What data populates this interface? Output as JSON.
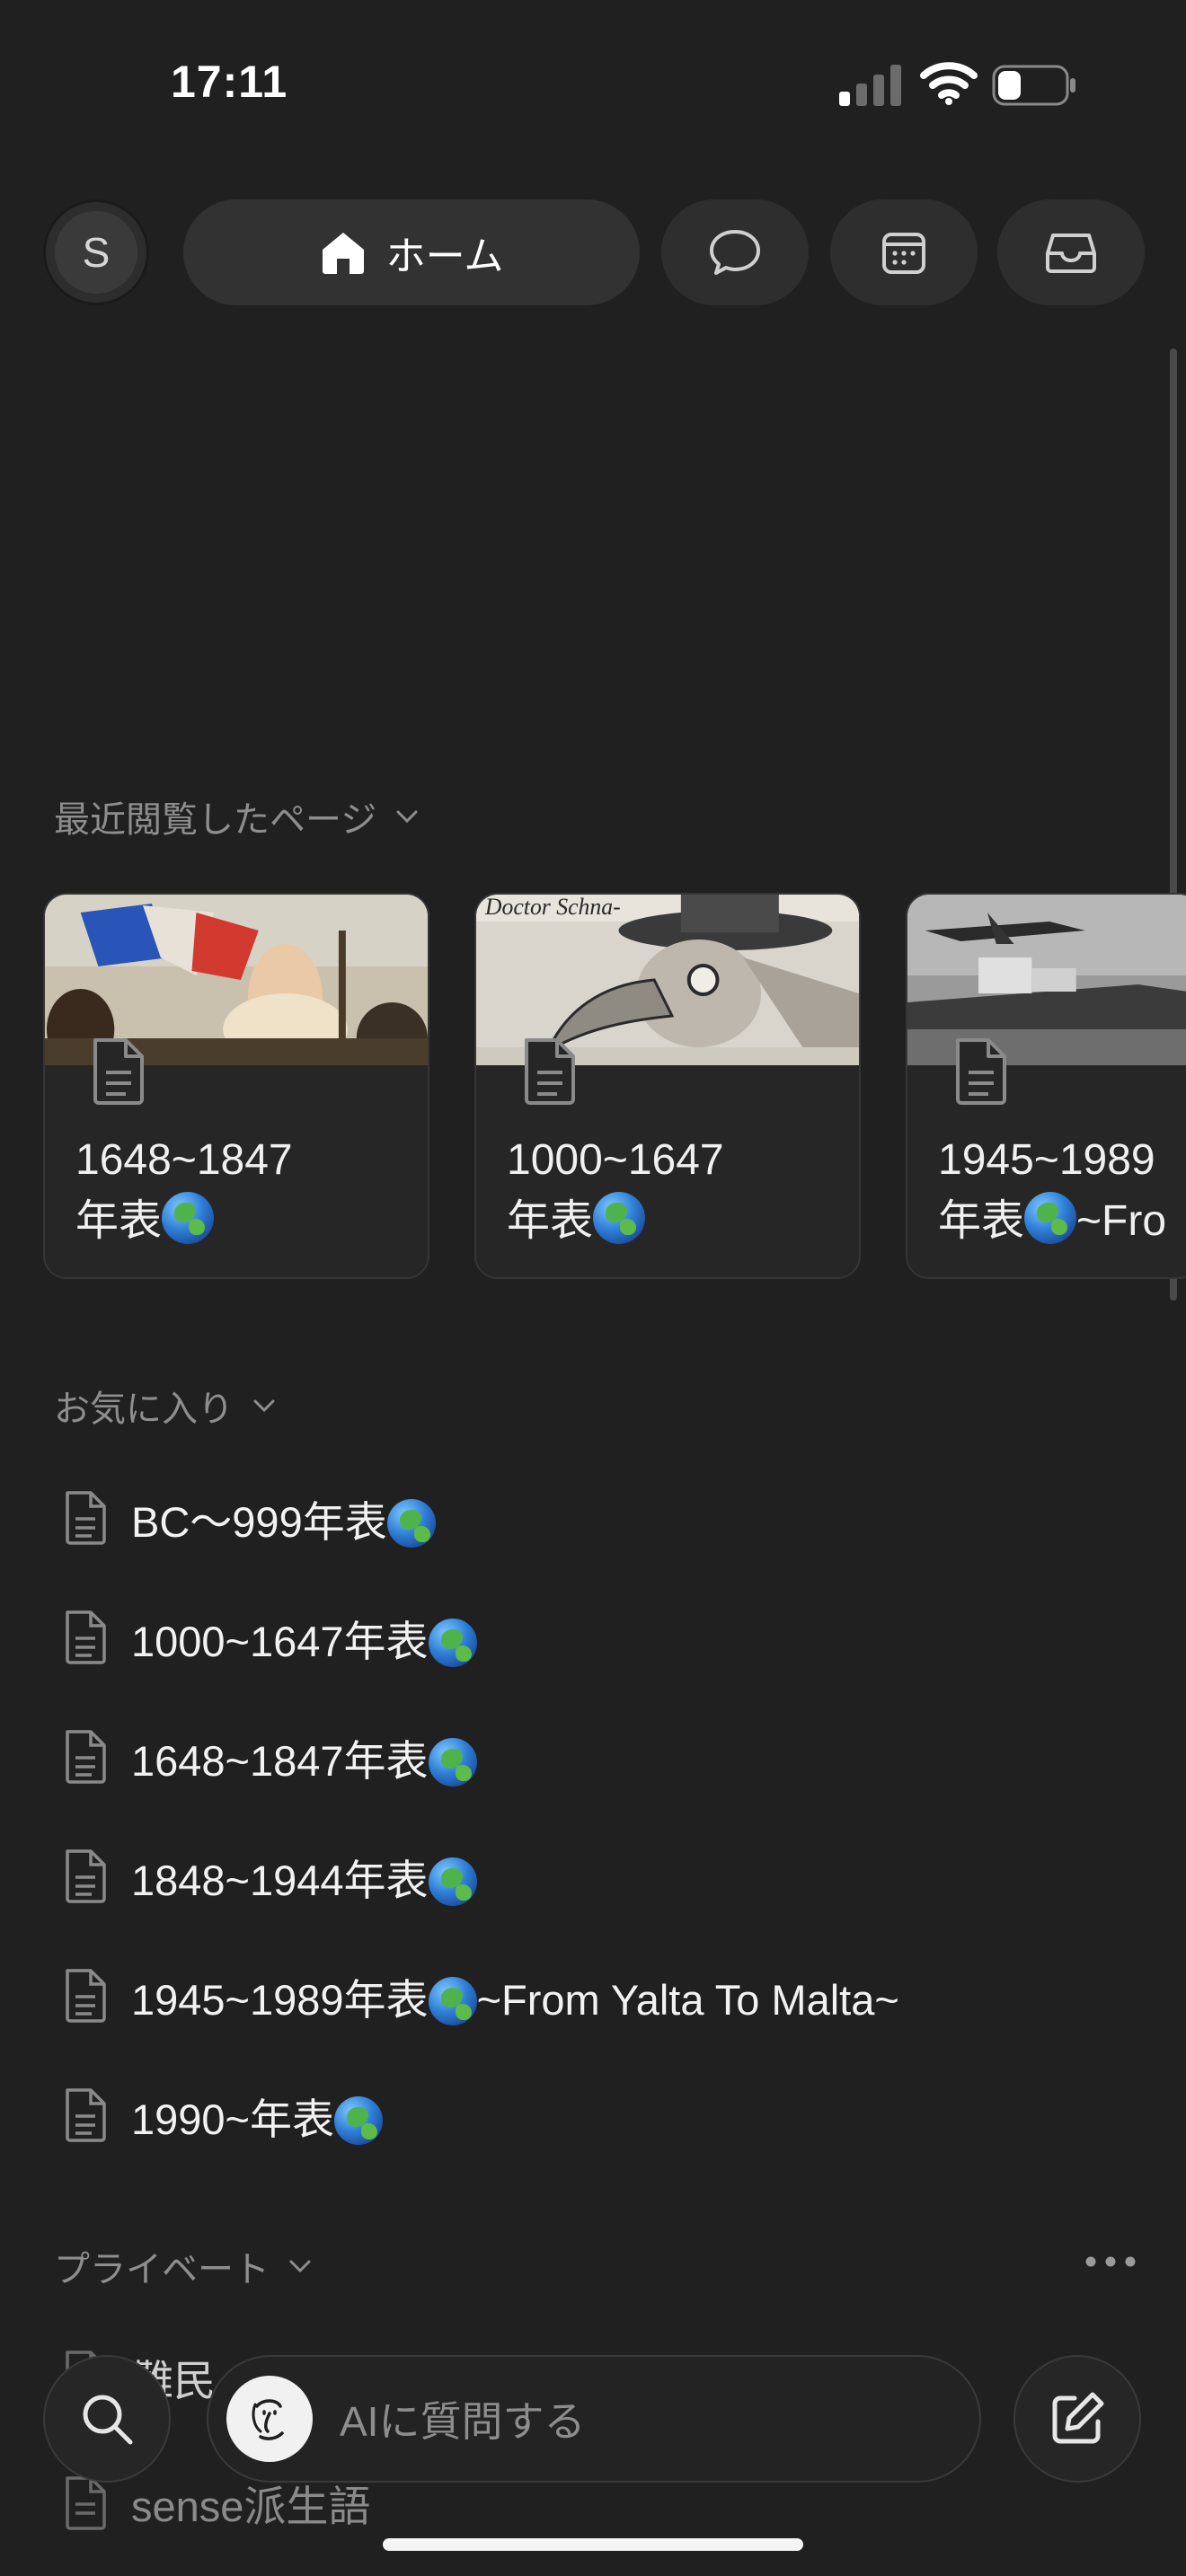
{
  "status": {
    "time": "17:11",
    "battery_level": 0.35
  },
  "nav": {
    "avatar_letter": "S",
    "home_label": "ホーム",
    "icons": [
      "chat-bubble-icon",
      "calendar-icon",
      "inbox-icon"
    ]
  },
  "recent": {
    "header": "最近閲覧したページ",
    "cards": [
      {
        "line1": "1648~1847",
        "line2": "年表",
        "cover": "liberty-painting"
      },
      {
        "line1": "1000~1647",
        "line2": "年表",
        "cover": "plague-doctor-engraving"
      },
      {
        "line1": "1945~1989",
        "line2": "年表",
        "line2_suffix": "~Fro",
        "cover": "bw-ship-airplane"
      }
    ]
  },
  "favorites": {
    "header": "お気に入り",
    "items": [
      {
        "label": "BC～999年表",
        "suffix": ""
      },
      {
        "label": "1000~1647年表",
        "suffix": ""
      },
      {
        "label": "1648~1847年表",
        "suffix": ""
      },
      {
        "label": "1848~1944年表",
        "suffix": ""
      },
      {
        "label": "1945~1989年表",
        "suffix": "~From Yalta To Malta~"
      },
      {
        "label": "1990~年表",
        "suffix": ""
      }
    ]
  },
  "private": {
    "header": "プライベート",
    "items": [
      {
        "label": "難民"
      },
      {
        "label": "sense派生語"
      }
    ]
  },
  "bottom": {
    "ask_placeholder": "AIに質問する"
  },
  "colors": {
    "background": "#202020",
    "card": "#262626",
    "pill": "#323232",
    "muted_text": "#8e8e8e"
  }
}
